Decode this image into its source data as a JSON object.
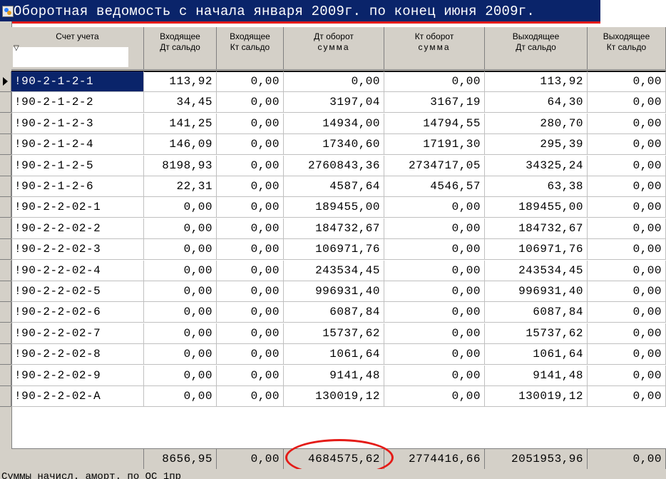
{
  "window": {
    "title": "Оборотная ведомость с начала января 2009г. по конец июня 2009г.",
    "title_bar_color": "#0a246a",
    "highlight_color": "#e41b17"
  },
  "columns": [
    {
      "line1": "Счет учета",
      "line2": ""
    },
    {
      "line1": "Входящее",
      "line2": "Дт сальдо"
    },
    {
      "line1": "Входящее",
      "line2": "Кт сальдо"
    },
    {
      "line1": "Дт оборот",
      "line2": "сумма"
    },
    {
      "line1": "Кт оборот",
      "line2": "сумма"
    },
    {
      "line1": "Выходящее",
      "line2": "Дт сальдо"
    },
    {
      "line1": "Выходящее",
      "line2": "Кт сальдо"
    }
  ],
  "filter_icon": "▽",
  "rows": [
    {
      "acct": "!90-2-1-2-1",
      "in_dt": "113,92",
      "in_kt": "0,00",
      "dt": "0,00",
      "kt": "0,00",
      "out_dt": "113,92",
      "out_kt": "0,00",
      "selected": true
    },
    {
      "acct": "!90-2-1-2-2",
      "in_dt": "34,45",
      "in_kt": "0,00",
      "dt": "3197,04",
      "kt": "3167,19",
      "out_dt": "64,30",
      "out_kt": "0,00"
    },
    {
      "acct": "!90-2-1-2-3",
      "in_dt": "141,25",
      "in_kt": "0,00",
      "dt": "14934,00",
      "kt": "14794,55",
      "out_dt": "280,70",
      "out_kt": "0,00"
    },
    {
      "acct": "!90-2-1-2-4",
      "in_dt": "146,09",
      "in_kt": "0,00",
      "dt": "17340,60",
      "kt": "17191,30",
      "out_dt": "295,39",
      "out_kt": "0,00"
    },
    {
      "acct": "!90-2-1-2-5",
      "in_dt": "8198,93",
      "in_kt": "0,00",
      "dt": "2760843,36",
      "kt": "2734717,05",
      "out_dt": "34325,24",
      "out_kt": "0,00"
    },
    {
      "acct": "!90-2-1-2-6",
      "in_dt": "22,31",
      "in_kt": "0,00",
      "dt": "4587,64",
      "kt": "4546,57",
      "out_dt": "63,38",
      "out_kt": "0,00"
    },
    {
      "acct": "!90-2-2-02-1",
      "in_dt": "0,00",
      "in_kt": "0,00",
      "dt": "189455,00",
      "kt": "0,00",
      "out_dt": "189455,00",
      "out_kt": "0,00"
    },
    {
      "acct": "!90-2-2-02-2",
      "in_dt": "0,00",
      "in_kt": "0,00",
      "dt": "184732,67",
      "kt": "0,00",
      "out_dt": "184732,67",
      "out_kt": "0,00"
    },
    {
      "acct": "!90-2-2-02-3",
      "in_dt": "0,00",
      "in_kt": "0,00",
      "dt": "106971,76",
      "kt": "0,00",
      "out_dt": "106971,76",
      "out_kt": "0,00"
    },
    {
      "acct": "!90-2-2-02-4",
      "in_dt": "0,00",
      "in_kt": "0,00",
      "dt": "243534,45",
      "kt": "0,00",
      "out_dt": "243534,45",
      "out_kt": "0,00"
    },
    {
      "acct": "!90-2-2-02-5",
      "in_dt": "0,00",
      "in_kt": "0,00",
      "dt": "996931,40",
      "kt": "0,00",
      "out_dt": "996931,40",
      "out_kt": "0,00"
    },
    {
      "acct": "!90-2-2-02-6",
      "in_dt": "0,00",
      "in_kt": "0,00",
      "dt": "6087,84",
      "kt": "0,00",
      "out_dt": "6087,84",
      "out_kt": "0,00"
    },
    {
      "acct": "!90-2-2-02-7",
      "in_dt": "0,00",
      "in_kt": "0,00",
      "dt": "15737,62",
      "kt": "0,00",
      "out_dt": "15737,62",
      "out_kt": "0,00"
    },
    {
      "acct": "!90-2-2-02-8",
      "in_dt": "0,00",
      "in_kt": "0,00",
      "dt": "1061,64",
      "kt": "0,00",
      "out_dt": "1061,64",
      "out_kt": "0,00"
    },
    {
      "acct": "!90-2-2-02-9",
      "in_dt": "0,00",
      "in_kt": "0,00",
      "dt": "9141,48",
      "kt": "0,00",
      "out_dt": "9141,48",
      "out_kt": "0,00"
    },
    {
      "acct": "!90-2-2-02-A",
      "in_dt": "0,00",
      "in_kt": "0,00",
      "dt": "130019,12",
      "kt": "0,00",
      "out_dt": "130019,12",
      "out_kt": "0,00"
    }
  ],
  "totals": {
    "in_dt": "8656,95",
    "in_kt": "0,00",
    "dt": "4684575,62",
    "kt": "2774416,66",
    "out_dt": "2051953,96",
    "out_kt": "0,00"
  },
  "status_text": "Суммы начисл. аморт. по ОС  1пр"
}
